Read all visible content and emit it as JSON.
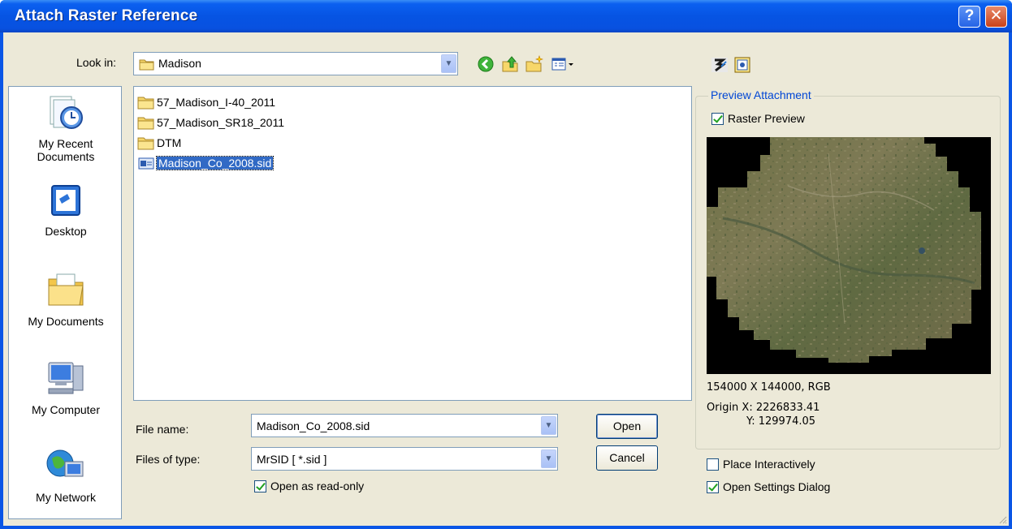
{
  "window": {
    "title": "Attach Raster Reference",
    "help_label": "?",
    "close_label": "✕"
  },
  "lookin": {
    "label": "Look in:",
    "value": "Madison"
  },
  "places": [
    {
      "line1": "My Recent",
      "line2": "Documents",
      "icon": "recent-documents-icon"
    },
    {
      "line1": "Desktop",
      "line2": "",
      "icon": "desktop-icon"
    },
    {
      "line1": "My Documents",
      "line2": "",
      "icon": "my-documents-icon"
    },
    {
      "line1": "My Computer",
      "line2": "",
      "icon": "my-computer-icon"
    },
    {
      "line1": "My Network",
      "line2": "",
      "icon": "network-icon"
    }
  ],
  "files": [
    {
      "name": "57_Madison_I-40_2011",
      "type": "folder"
    },
    {
      "name": "57_Madison_SR18_2011",
      "type": "folder"
    },
    {
      "name": "DTM",
      "type": "folder"
    },
    {
      "name": "Madison_Co_2008.sid",
      "type": "sid",
      "selected": true
    }
  ],
  "filename": {
    "label": "File name:",
    "value": "Madison_Co_2008.sid"
  },
  "filetype": {
    "label": "Files of type:",
    "value": "MrSID [ *.sid ]"
  },
  "buttons": {
    "open": "Open",
    "cancel": "Cancel"
  },
  "readonly": {
    "label": "Open as read-only",
    "checked": true
  },
  "preview": {
    "legend": "Preview Attachment",
    "raster_preview_label": "Raster Preview",
    "raster_preview_checked": true,
    "dimensions": "154000 X 144000, RGB",
    "origin_x": "Origin X: 2226833.41",
    "origin_y": "Y: 129974.05"
  },
  "place_interactively": {
    "label": "Place Interactively",
    "checked": false
  },
  "open_settings": {
    "label": "Open Settings Dialog",
    "checked": true
  }
}
